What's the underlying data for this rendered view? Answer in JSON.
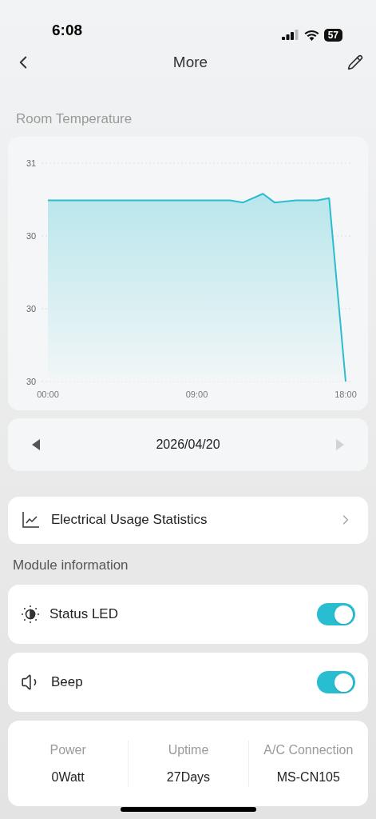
{
  "status_bar": {
    "time": "6:08",
    "battery": "57"
  },
  "nav": {
    "title": "More"
  },
  "temperature": {
    "title": "Room Temperature",
    "chart_data": {
      "type": "area",
      "x": [
        0,
        11,
        11.8,
        13,
        13.7,
        15,
        16.3,
        17,
        18
      ],
      "series": [
        {
          "color": "#2bbcd0",
          "values": [
            30.498,
            30.498,
            30.492,
            30.516,
            30.492,
            30.498,
            30.498,
            30.504,
            30
          ]
        }
      ],
      "xlim": [
        0,
        18
      ],
      "ylim": [
        30,
        30.6
      ],
      "xticks": [
        {
          "value": 0,
          "label": "00:00"
        },
        {
          "value": 9,
          "label": "09:00"
        },
        {
          "value": 18,
          "label": "18:00"
        }
      ],
      "yticks": [
        {
          "value": 30.6,
          "label": "31"
        },
        {
          "value": 30.4,
          "label": "30"
        },
        {
          "value": 30.2,
          "label": "30"
        },
        {
          "value": 30,
          "label": "30"
        }
      ]
    }
  },
  "date_picker": {
    "date": "2026/04/20",
    "prev_disabled": false,
    "next_disabled": true
  },
  "usage_link": {
    "label": "Electrical Usage Statistics"
  },
  "module_section": {
    "title": "Module information"
  },
  "settings": [
    {
      "kind": "led",
      "label": "Status LED",
      "on": true
    },
    {
      "kind": "beep",
      "label": "Beep",
      "on": true
    }
  ],
  "stats": [
    {
      "label": "Power",
      "value": "0Watt"
    },
    {
      "label": "Uptime",
      "value": "27Days"
    },
    {
      "label": "A/C Connection",
      "value": "MS-CN105"
    }
  ]
}
